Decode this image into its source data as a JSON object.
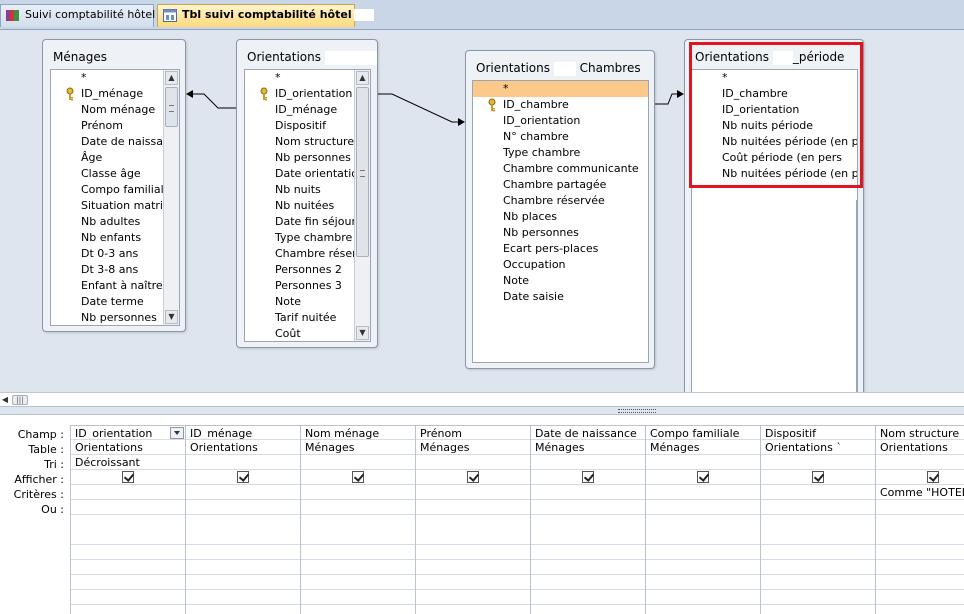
{
  "tabs": [
    {
      "label": "Suivi comptabilité hôtel",
      "active": false
    },
    {
      "label": "Tbl suivi comptabilité hôtel",
      "active": true
    }
  ],
  "tables": {
    "menages": {
      "title": "Ménages",
      "fields": [
        "*",
        "ID_ménage",
        "Nom ménage",
        "Prénom",
        "Date de naissan",
        "Âge",
        "Classe âge",
        "Compo familiale",
        "Situation matrim",
        "Nb adultes",
        "Nb enfants",
        "Dt 0-3 ans",
        "Dt 3-8 ans",
        "Enfant à naître",
        "Date terme",
        "Nb personnes"
      ],
      "key_field": "ID_ménage"
    },
    "orientations": {
      "title": "Orientations",
      "fields": [
        "*",
        "ID_orientation",
        "ID_ménage",
        "Dispositif",
        "Nom structure",
        "Nb personnes",
        "Date orientatio",
        "Nb nuits",
        "Nb nuitées",
        "Date fin séjour",
        "Type chambre",
        "Chambre réserv",
        "Personnes 2",
        "Personnes 3",
        "Note",
        "Tarif nuitée",
        "Coût"
      ],
      "key_field": "ID_orientation"
    },
    "orientations_chambres": {
      "title_part1": "Orientations",
      "title_part2": "Chambres",
      "fields": [
        "*",
        "ID_chambre",
        "ID_orientation",
        "N° chambre",
        "Type chambre",
        "Chambre communicante",
        "Chambre partagée",
        "Chambre réservée",
        "Nb places",
        "Nb personnes",
        "Ecart pers-places",
        "Occupation",
        "Note",
        "Date saisie"
      ],
      "key_field": "ID_chambre",
      "selected_field": "*"
    },
    "orientations_periode": {
      "title_part1": "Orientations",
      "title_part2": "_période",
      "fields": [
        "*",
        "ID_chambre",
        "ID_orientation",
        "Nb nuits période",
        "Nb nuitées période (en pe",
        "Coût        période (en pers",
        "Nb nuitées période (en pla"
      ]
    }
  },
  "qbe": {
    "row_labels": [
      "Champ :",
      "Table :",
      "Tri :",
      "Afficher :",
      "Critères :",
      "Ou :"
    ],
    "columns": [
      {
        "field": "ID_orientation",
        "table": "Orientations",
        "sort": "Décroissant",
        "show": true,
        "criteria": "",
        "dropdown": true
      },
      {
        "field": "ID_ménage",
        "table": "Orientations",
        "sort": "",
        "show": true,
        "criteria": ""
      },
      {
        "field": "Nom ménage",
        "table": "Ménages",
        "sort": "",
        "show": true,
        "criteria": ""
      },
      {
        "field": "Prénom",
        "table": "Ménages",
        "sort": "",
        "show": true,
        "criteria": ""
      },
      {
        "field": "Date de naissance",
        "table": "Ménages",
        "sort": "",
        "show": true,
        "criteria": ""
      },
      {
        "field": "Compo familiale",
        "table": "Ménages",
        "sort": "",
        "show": true,
        "criteria": ""
      },
      {
        "field": "Dispositif",
        "table": "Orientations `",
        "sort": "",
        "show": true,
        "criteria": ""
      },
      {
        "field": "Nom structure",
        "table": "Orientations",
        "sort": "",
        "show": true,
        "criteria": "Comme \"HOTEL*\""
      }
    ]
  },
  "colors": {
    "highlight": "#e0161c",
    "selected_row": "#fbc98a",
    "design_bg": "#dfe5ee"
  }
}
